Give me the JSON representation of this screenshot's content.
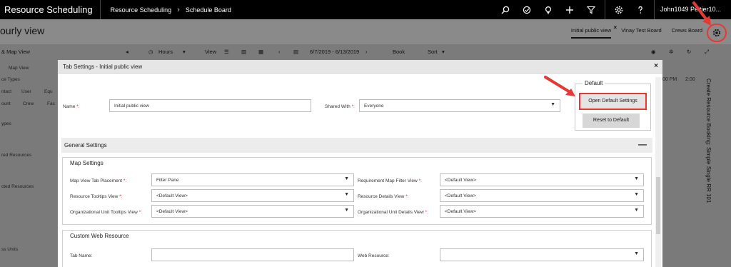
{
  "topbar": {
    "app_title": "Resource Scheduling",
    "breadcrumb_1": "Resource Scheduling",
    "breadcrumb_sep": "›",
    "breadcrumb_2": "Schedule Board",
    "user": "John1049 Peltier10..."
  },
  "header": {
    "page_title": "ourly view",
    "tabs": [
      "Initial public view",
      "Vinay Test Board",
      "Crews Board"
    ],
    "tab_close": "×"
  },
  "toolbar": {
    "left_label": "& Map View",
    "hours": "Hours",
    "view": "View",
    "date_range": "6/7/2019 - 6/13/2019",
    "book": "Book",
    "sort": "Sort"
  },
  "background": {
    "left_items": [
      "Map View",
      "ce Types",
      "ntact",
      "User",
      "Equ",
      "ount",
      "Crew",
      "Fac",
      "ypes",
      "red Resources",
      "cted Resources",
      "ss Units"
    ],
    "times": [
      "00 PM",
      "2:00"
    ],
    "vertical_text": "Create Resource Booking: Simple Single RR 101"
  },
  "modal": {
    "title": "Tab Settings - Initial public view",
    "close": "×",
    "name_label": "Name",
    "name_value": "Initial public view",
    "shared_label": "Shared With",
    "shared_value": "Everyone",
    "default_legend": "Default",
    "open_default_btn": "Open Default Settings",
    "reset_default_btn": "Reset to Default",
    "general_settings": "General Settings",
    "collapse": "—",
    "map_settings": "Map Settings",
    "map_fields": [
      {
        "label": "Map View Tab Placement",
        "required": true,
        "value": "Filter Pane"
      },
      {
        "label": "Requirement Map Filter View",
        "required": true,
        "value": "<Default View>"
      },
      {
        "label": "Resource Tooltips View",
        "required": true,
        "value": "<Default View>"
      },
      {
        "label": "Resource Details View",
        "required": true,
        "value": "<Default View>"
      },
      {
        "label": "Organizational Unit Tooltips View",
        "required": true,
        "value": "<Default View>"
      },
      {
        "label": "Organizational Unit Details View",
        "required": true,
        "value": "<Default View>"
      }
    ],
    "custom_web_resource": "Custom Web Resource",
    "tab_name_label": "Tab Name:",
    "web_resource_label": "Web Resource:",
    "required_marker": "*:"
  },
  "colors": {
    "highlight": "#e53935"
  }
}
